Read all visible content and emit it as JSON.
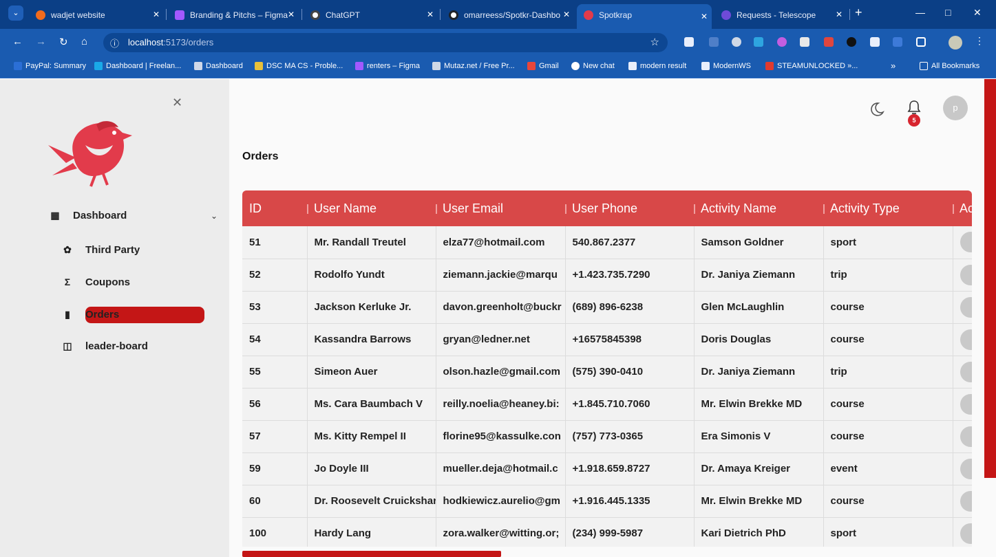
{
  "browser": {
    "tabs": [
      {
        "title": "wadjet website",
        "color": "#f26b1d"
      },
      {
        "title": "Branding & Pitchs – Figma",
        "color": "#a259ff"
      },
      {
        "title": "ChatGPT",
        "color": "#ffffff"
      },
      {
        "title": "omarreess/Spotkr-Dashbo",
        "color": "#ffffff"
      },
      {
        "title": "Spotkrap",
        "color": "#e23b4b"
      },
      {
        "title": "Requests - Telescope",
        "color": "#6f4bd8"
      }
    ],
    "url_host": "localhost",
    "url_path": ":5173/orders",
    "bookmarks": [
      "PayPal: Summary",
      "Dashboard | Freelan...",
      "Dashboard",
      "DSC MA CS - Proble...",
      "renters – Figma",
      "Mutaz.net / Free Pr...",
      "Gmail",
      "New chat",
      "modern result",
      "ModernWS",
      "STEAMUNLOCKED »...",
      "All Bookmarks"
    ],
    "overflow": "»"
  },
  "sidebar": {
    "items": [
      {
        "label": "Dashboard",
        "icon": "grid-icon"
      },
      {
        "label": "Third Party",
        "icon": "party-icon"
      },
      {
        "label": "Coupons",
        "icon": "coupon-icon"
      },
      {
        "label": "Orders",
        "icon": "book-icon"
      },
      {
        "label": "leader-board",
        "icon": "leaderboard-icon"
      }
    ],
    "active": "Orders"
  },
  "header": {
    "notification_count": "5",
    "avatar_initial": "p"
  },
  "page": {
    "title": "Orders"
  },
  "orders": {
    "columns": [
      "ID",
      "User Name",
      "User Email",
      "User Phone",
      "Activity Name",
      "Activity Type",
      "Ac"
    ],
    "rows": [
      [
        "51",
        "Mr. Randall Treutel",
        "elza77@hotmail.com",
        "540.867.2377",
        "Samson Goldner",
        "sport"
      ],
      [
        "52",
        "Rodolfo Yundt",
        "ziemann.jackie@marqu",
        "+1.423.735.7290",
        "Dr. Janiya Ziemann",
        "trip"
      ],
      [
        "53",
        "Jackson Kerluke Jr.",
        "davon.greenholt@buckr",
        "(689) 896-6238",
        "Glen McLaughlin",
        "course"
      ],
      [
        "54",
        "Kassandra Barrows",
        "gryan@ledner.net",
        "+16575845398",
        "Doris Douglas",
        "course"
      ],
      [
        "55",
        "Simeon Auer",
        "olson.hazle@gmail.com",
        "(575) 390-0410",
        "Dr. Janiya Ziemann",
        "trip"
      ],
      [
        "56",
        "Ms. Cara Baumbach V",
        "reilly.noelia@heaney.bi:",
        "+1.845.710.7060",
        "Mr. Elwin Brekke MD",
        "course"
      ],
      [
        "57",
        "Ms. Kitty Rempel II",
        "florine95@kassulke.con",
        "(757) 773-0365",
        "Era Simonis V",
        "course"
      ],
      [
        "59",
        "Jo Doyle III",
        "mueller.deja@hotmail.c",
        "+1.918.659.8727",
        "Dr. Amaya Kreiger",
        "event"
      ],
      [
        "60",
        "Dr. Roosevelt Cruickshar",
        "hodkiewicz.aurelio@gm",
        "+1.916.445.1335",
        "Mr. Elwin Brekke MD",
        "course"
      ],
      [
        "100",
        "Hardy Lang",
        "zora.walker@witting.or;",
        "(234) 999-5987",
        "Kari Dietrich PhD",
        "sport"
      ]
    ]
  },
  "colors": {
    "accent": "#c41616",
    "table_header": "#d84848",
    "brand_bird": "#e23b4b"
  }
}
